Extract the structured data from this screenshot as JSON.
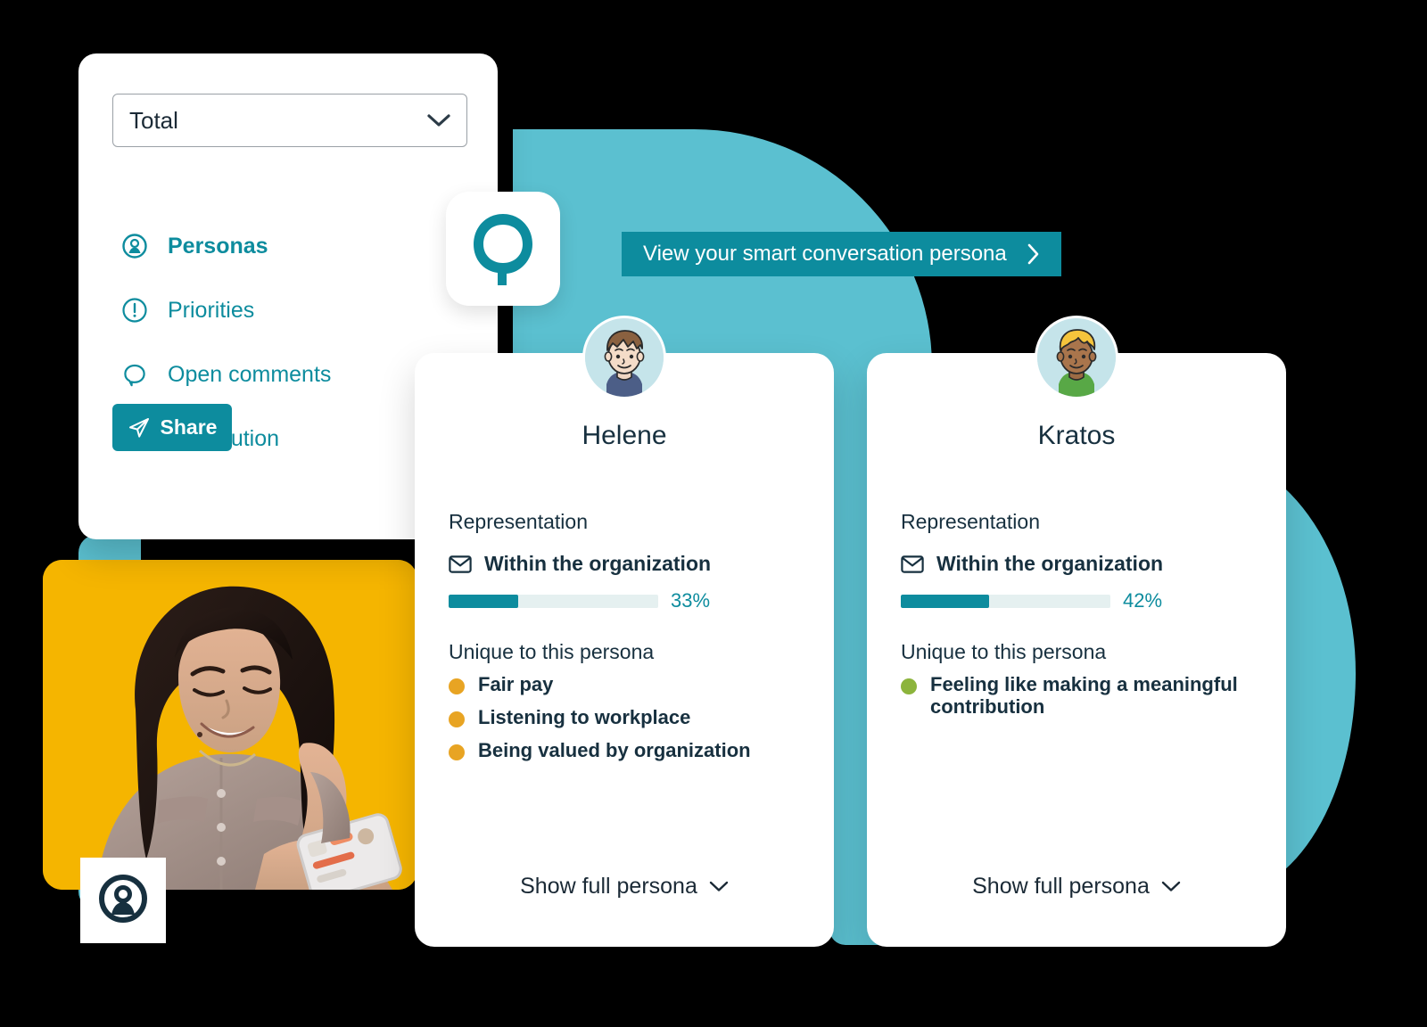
{
  "colors": {
    "teal_dark": "#0D8C9E",
    "teal_light": "#5BC0D0",
    "yellow": "#F5B500",
    "navy": "#17303F",
    "bullet_orange": "#E8A423",
    "bullet_green": "#8CB43C",
    "bar_track": "#E5F0F0"
  },
  "panel": {
    "filter": {
      "value": "Total",
      "placeholder": "Total",
      "chevron_icon": "chevron-down-icon"
    },
    "nav": [
      {
        "label": "Personas",
        "icon": "person-circle-icon",
        "active": true
      },
      {
        "label": "Priorities",
        "icon": "exclamation-circle-icon",
        "active": false
      },
      {
        "label": "Open comments",
        "icon": "speech-bubble-icon",
        "active": false
      },
      {
        "label": "Distribution",
        "icon": "grid-squares-icon",
        "active": false
      }
    ],
    "share": {
      "label": "Share",
      "icon": "paper-plane-icon"
    }
  },
  "logo_tile": {
    "icon": "questback-q-logo-icon"
  },
  "logo_badge": {
    "icon": "persona-person-logo-icon"
  },
  "cta": {
    "label": "View your smart conversation persona",
    "icon": "chevron-right-icon"
  },
  "photo": {
    "alt": "smiling woman looking at smartphone"
  },
  "personas": [
    {
      "name": "Helene",
      "avatar_icon": "avatar-brown-hair-icon",
      "representation_label": "Representation",
      "representation_item": "Within the organization",
      "representation_icon": "envelope-icon",
      "percent_value": 33,
      "percent_text": "33%",
      "unique_label": "Unique to this persona",
      "unique_items": [
        {
          "text": "Fair pay",
          "color": "#E8A423"
        },
        {
          "text": "Listening to workplace",
          "color": "#E8A423"
        },
        {
          "text": "Being valued by organization",
          "color": "#E8A423"
        }
      ],
      "show_full_label": "Show full persona",
      "show_full_icon": "chevron-down-icon"
    },
    {
      "name": "Kratos",
      "avatar_icon": "avatar-blond-hair-icon",
      "representation_label": "Representation",
      "representation_item": "Within the organization",
      "representation_icon": "envelope-icon",
      "percent_value": 42,
      "percent_text": "42%",
      "unique_label": "Unique to this persona",
      "unique_items": [
        {
          "text": "Feeling like making a meaningful contribution",
          "color": "#8CB43C"
        }
      ],
      "show_full_label": "Show full persona",
      "show_full_icon": "chevron-down-icon"
    }
  ]
}
